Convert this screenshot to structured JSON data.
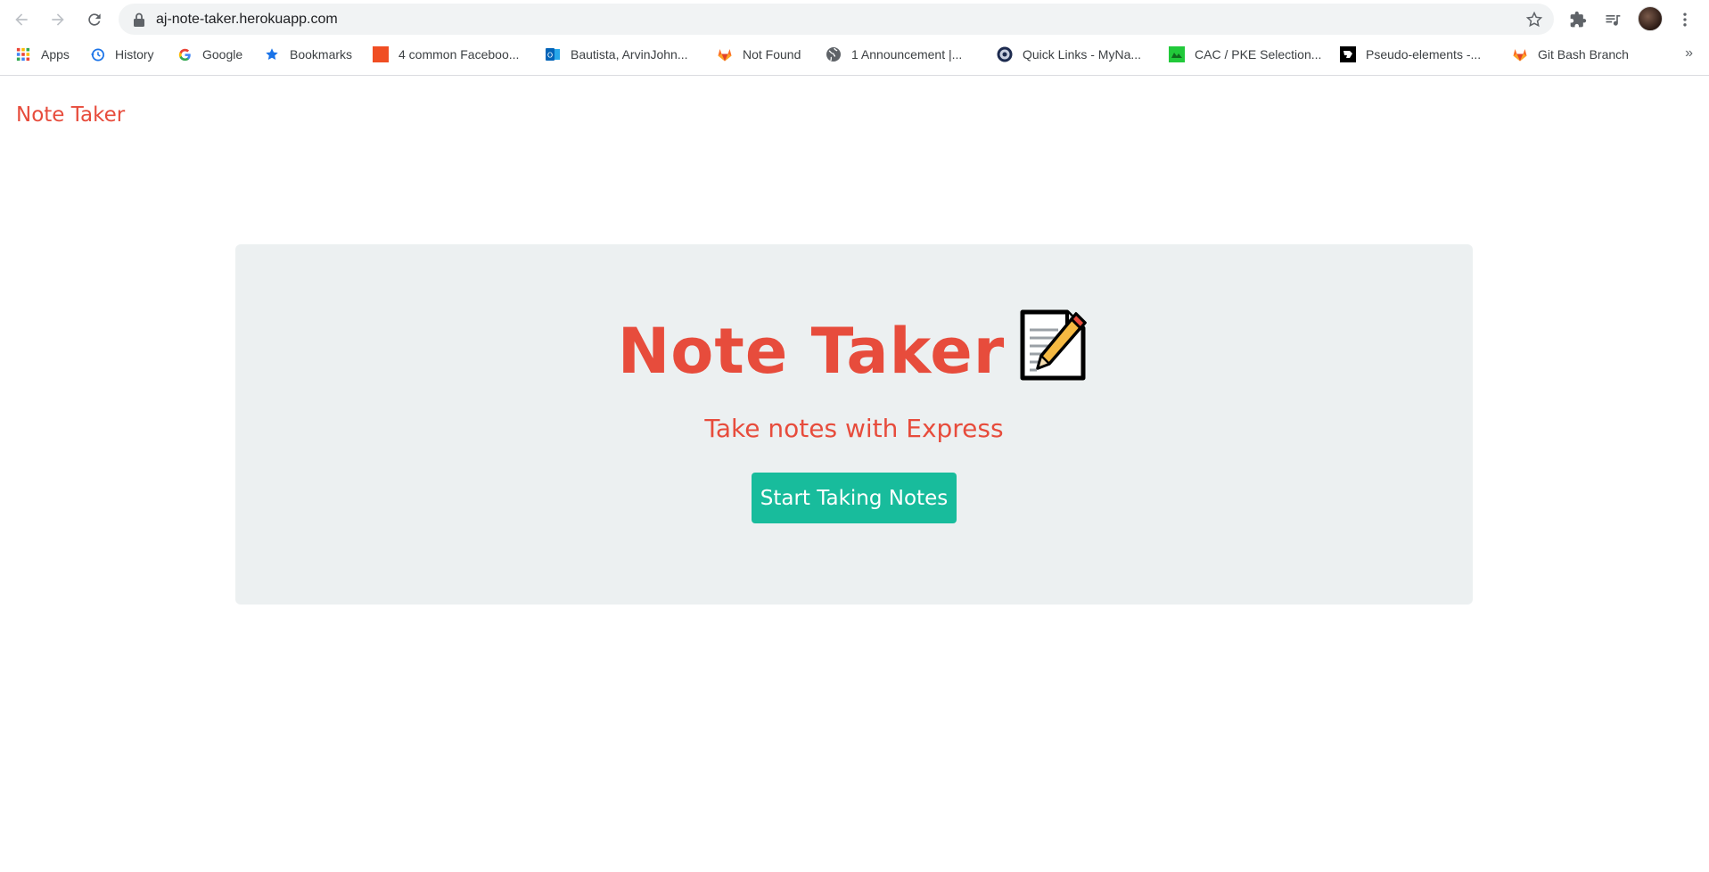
{
  "browser": {
    "url": "aj-note-taker.herokuapp.com",
    "bookmarks": [
      {
        "label": "Apps",
        "icon": "apps-grid-icon"
      },
      {
        "label": "History",
        "icon": "history-icon"
      },
      {
        "label": "Google",
        "icon": "google-icon"
      },
      {
        "label": "Bookmarks",
        "icon": "star-icon"
      },
      {
        "label": "4 common Faceboo...",
        "icon": "orange-square-icon"
      },
      {
        "label": "Bautista, ArvinJohn...",
        "icon": "outlook-icon"
      },
      {
        "label": "Not Found",
        "icon": "gitlab-icon"
      },
      {
        "label": "1 Announcement |...",
        "icon": "globe-icon"
      },
      {
        "label": "Quick Links - MyNa...",
        "icon": "seal-icon"
      },
      {
        "label": "CAC / PKE Selection...",
        "icon": "green-square-icon"
      },
      {
        "label": "Pseudo-elements -...",
        "icon": "black-square-icon"
      },
      {
        "label": "Git Bash Branch",
        "icon": "gitlab-icon"
      }
    ],
    "more": "»"
  },
  "navbar": {
    "brand": "Note Taker"
  },
  "hero": {
    "title": "Note Taker",
    "subtitle": "Take notes with Express",
    "button_label": "Start Taking Notes"
  },
  "colors": {
    "accent": "#e74c3c",
    "button": "#18bc9c",
    "jumbotron_bg": "#ecf0f1"
  }
}
